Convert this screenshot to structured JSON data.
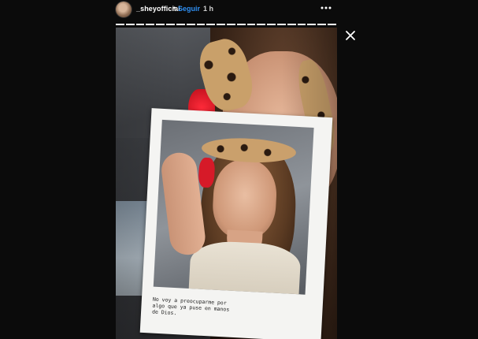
{
  "header": {
    "username": "_sheyofficial",
    "separator": "•",
    "follow_label": "Seguir",
    "time_ago": "1 h",
    "more_icon": "more-horizontal-icon"
  },
  "progress": {
    "segments_total": 22,
    "segments_done": 22
  },
  "controls": {
    "close_icon": "close-icon"
  },
  "story": {
    "caption": "No voy a preocuparme por\nalgo que ya puse en manos\nde Dios."
  },
  "colors": {
    "background": "#0b0b0b",
    "link": "#2f8ff2",
    "text": "#ffffff"
  }
}
